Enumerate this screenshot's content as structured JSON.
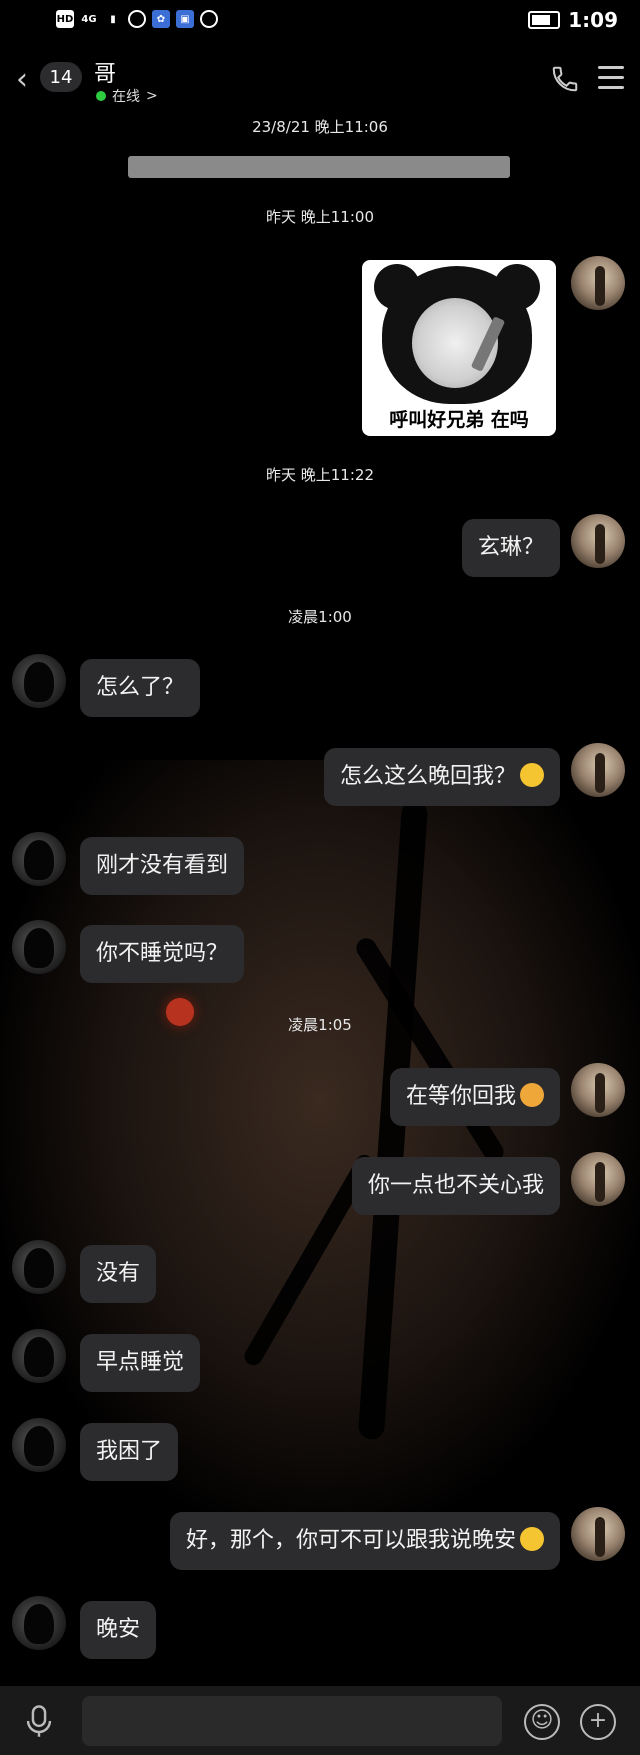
{
  "status_bar": {
    "time": "1:09",
    "left_icons": [
      "hd-icon",
      "4g-signal-icon",
      "cellular-signal-icon",
      "app-icon",
      "baidu-icon",
      "app-icon",
      "hand-icon"
    ]
  },
  "header": {
    "unread_count": "14",
    "contact_name": "哥",
    "status": "在线",
    "status_chevron": ">"
  },
  "timestamps": [
    "23/8/21 晚上11:06",
    "昨天 晚上11:00",
    "昨天 晚上11:22",
    "凌晨1:00",
    "凌晨1:05"
  ],
  "sticker": {
    "caption": "呼叫好兄弟 在吗"
  },
  "messages": [
    {
      "from": "me",
      "text": "玄琳？"
    },
    {
      "from": "them",
      "text": "怎么了？"
    },
    {
      "from": "me",
      "text": "怎么这么晚回我？",
      "emoji": "smirk-emoji"
    },
    {
      "from": "them",
      "text": "刚才没有看到"
    },
    {
      "from": "them",
      "text": "你不睡觉吗？"
    },
    {
      "from": "me",
      "text": "在等你回我",
      "emoji": "angry-emoji"
    },
    {
      "from": "me",
      "text": "你一点也不关心我"
    },
    {
      "from": "them",
      "text": "没有"
    },
    {
      "from": "them",
      "text": "早点睡觉"
    },
    {
      "from": "them",
      "text": "我困了"
    },
    {
      "from": "me",
      "text": "好，那个，你可不可以跟我说晚安",
      "emoji": "crying-laugh-emoji"
    },
    {
      "from": "them",
      "text": "晚安"
    }
  ],
  "colors": {
    "bubble": "#2c2c2e",
    "background": "#000000",
    "online_dot": "#2ecc40"
  }
}
